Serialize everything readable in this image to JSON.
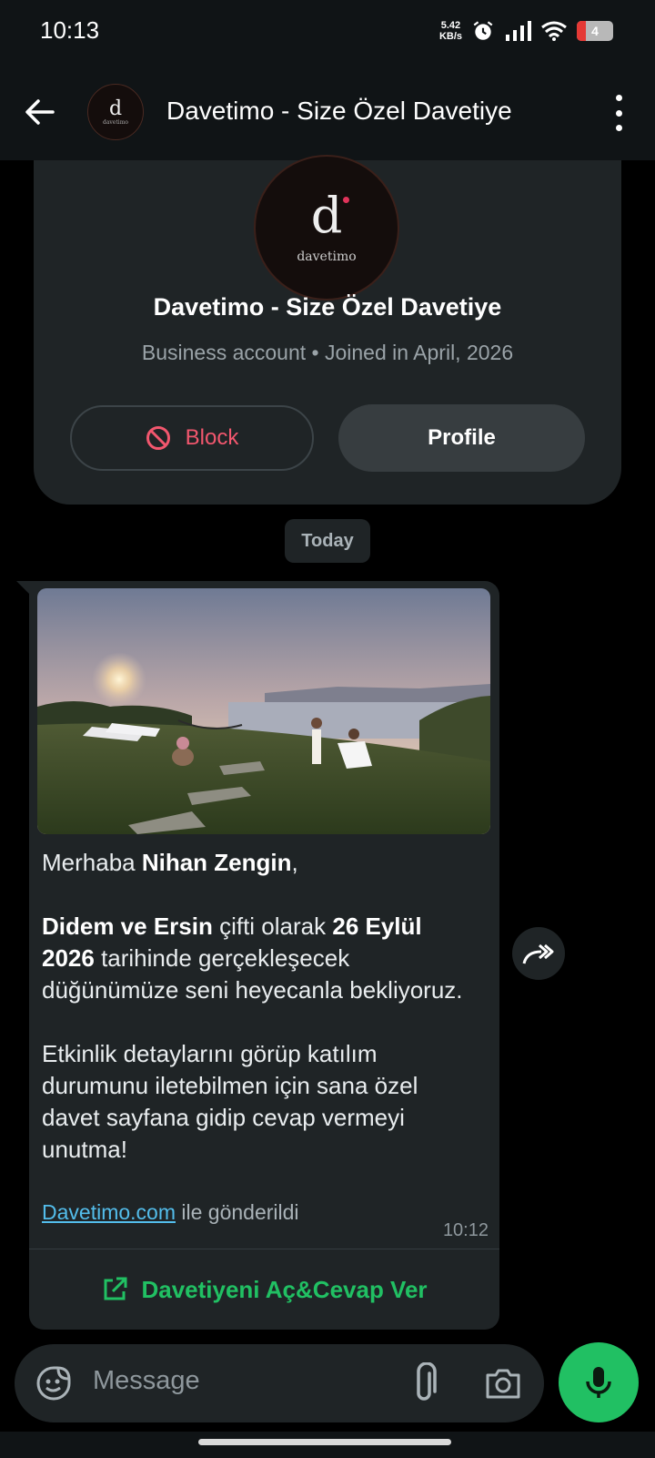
{
  "status_bar": {
    "time": "10:13",
    "net_speed_value": "5.42",
    "net_speed_unit": "KB/s",
    "battery_level": "4",
    "icons": [
      "alarm-icon",
      "signal-icon",
      "wifi-icon",
      "battery-icon"
    ]
  },
  "header": {
    "title": "Davetimo - Size Özel Davetiye",
    "avatar_letter": "d",
    "avatar_wordmark": "davetimo"
  },
  "profile_card": {
    "avatar_letter": "d",
    "avatar_wordmark": "davetimo",
    "name": "Davetimo - Size Özel Davetiye",
    "subtitle": "Business account • Joined in April, 2026",
    "block_label": "Block",
    "profile_label": "Profile"
  },
  "chat": {
    "date_chip": "Today",
    "message": {
      "greeting_prefix": "Merhaba ",
      "recipient": "Nihan Zengin",
      "greeting_suffix": ",",
      "couple": "Didem ve Ersin",
      "couple_suffix": " çifti olarak ",
      "date": "26 Eylül 2026",
      "p2_rest": " tarihinde gerçekleşecek düğünümüze seni heyecanla bekliyoruz.",
      "p3": "Etkinlik detaylarını görüp katılım durumunu iletebilmen için sana özel davet sayfana gidip cevap vermeyi unutma!",
      "footer_link": "Davetimo.com",
      "footer_rest": " ile gönderildi",
      "time": "10:12",
      "action_label": "Davetiyeni Aç&Cevap Ver"
    }
  },
  "composer": {
    "placeholder": "Message"
  },
  "colors": {
    "accent_green": "#21c063",
    "block_red": "#f2576e",
    "link_blue": "#53bdeb",
    "bubble_bg": "#1f2426"
  }
}
